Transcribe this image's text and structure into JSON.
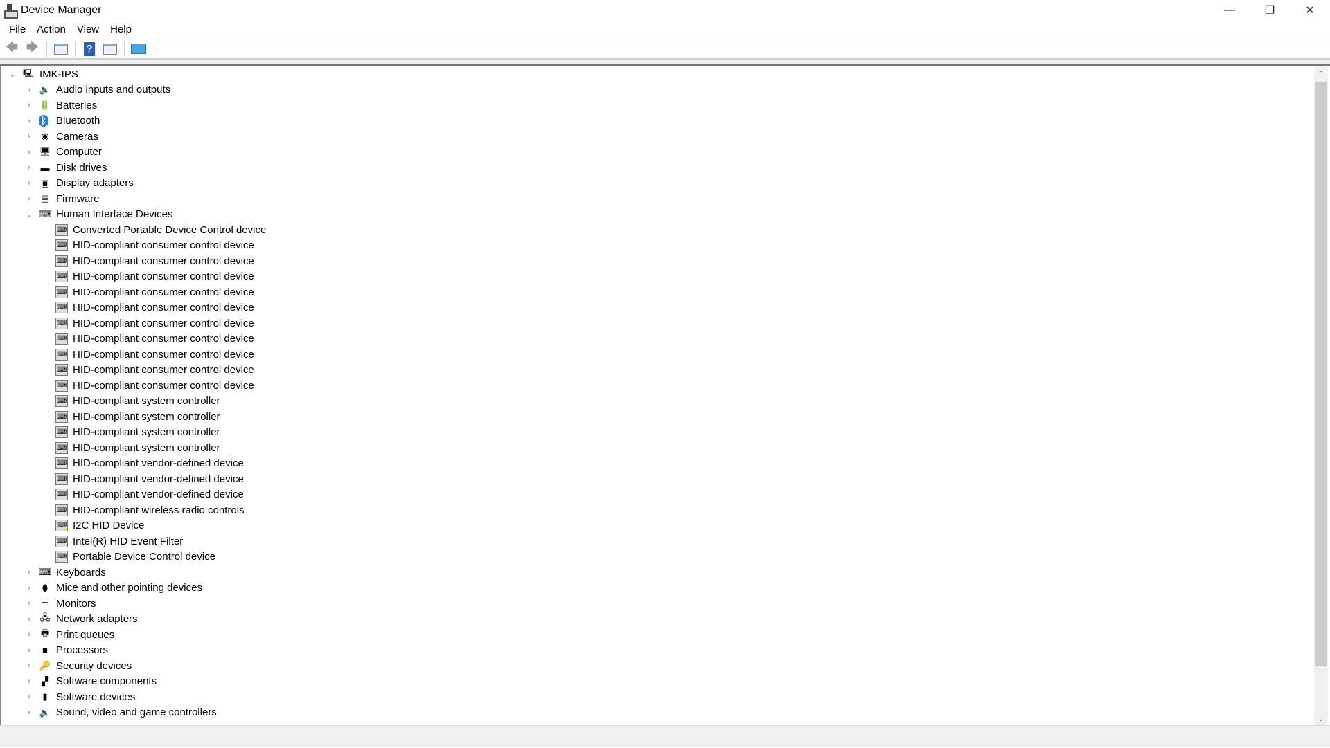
{
  "window": {
    "title": "Device Manager",
    "controls": [
      "minimize",
      "restore",
      "close"
    ]
  },
  "menu": [
    "File",
    "Action",
    "View",
    "Help"
  ],
  "toolbar": [
    "back-icon",
    "forward-icon",
    "show-hide-console-tree-icon",
    "help-icon",
    "show-action-pane-icon",
    "scan-hardware-icon"
  ],
  "tree": {
    "root": "IMK-IPS",
    "categories": [
      {
        "label": "Audio inputs and outputs",
        "icon": "speaker-icon",
        "expanded": false
      },
      {
        "label": "Batteries",
        "icon": "battery-icon",
        "expanded": false
      },
      {
        "label": "Bluetooth",
        "icon": "bluetooth-icon",
        "expanded": false
      },
      {
        "label": "Cameras",
        "icon": "camera-icon",
        "expanded": false
      },
      {
        "label": "Computer",
        "icon": "computer-icon",
        "expanded": false
      },
      {
        "label": "Disk drives",
        "icon": "disk-icon",
        "expanded": false
      },
      {
        "label": "Display adapters",
        "icon": "display-adapter-icon",
        "expanded": false
      },
      {
        "label": "Firmware",
        "icon": "firmware-icon",
        "expanded": false
      },
      {
        "label": "Human Interface Devices",
        "icon": "hid-icon",
        "expanded": true,
        "children": [
          {
            "label": "Converted Portable Device Control device"
          },
          {
            "label": "HID-compliant consumer control device"
          },
          {
            "label": "HID-compliant consumer control device"
          },
          {
            "label": "HID-compliant consumer control device"
          },
          {
            "label": "HID-compliant consumer control device"
          },
          {
            "label": "HID-compliant consumer control device"
          },
          {
            "label": "HID-compliant consumer control device"
          },
          {
            "label": "HID-compliant consumer control device"
          },
          {
            "label": "HID-compliant consumer control device"
          },
          {
            "label": "HID-compliant consumer control device"
          },
          {
            "label": "HID-compliant consumer control device"
          },
          {
            "label": "HID-compliant system controller"
          },
          {
            "label": "HID-compliant system controller"
          },
          {
            "label": "HID-compliant system controller"
          },
          {
            "label": "HID-compliant system controller"
          },
          {
            "label": "HID-compliant vendor-defined device"
          },
          {
            "label": "HID-compliant vendor-defined device"
          },
          {
            "label": "HID-compliant vendor-defined device"
          },
          {
            "label": "HID-compliant wireless radio controls"
          },
          {
            "label": "I2C HID Device",
            "warning": true
          },
          {
            "label": "Intel(R) HID Event Filter"
          },
          {
            "label": "Portable Device Control device"
          }
        ]
      },
      {
        "label": "Keyboards",
        "icon": "keyboard-icon",
        "expanded": false
      },
      {
        "label": "Mice and other pointing devices",
        "icon": "mouse-icon",
        "expanded": false
      },
      {
        "label": "Monitors",
        "icon": "monitor-icon",
        "expanded": false
      },
      {
        "label": "Network adapters",
        "icon": "network-icon",
        "expanded": false
      },
      {
        "label": "Print queues",
        "icon": "printer-icon",
        "expanded": false
      },
      {
        "label": "Processors",
        "icon": "processor-icon",
        "expanded": false
      },
      {
        "label": "Security devices",
        "icon": "security-icon",
        "expanded": false
      },
      {
        "label": "Software components",
        "icon": "software-component-icon",
        "expanded": false
      },
      {
        "label": "Software devices",
        "icon": "software-device-icon",
        "expanded": false
      },
      {
        "label": "Sound, video and game controllers",
        "icon": "speaker-icon",
        "expanded": false
      }
    ]
  },
  "colors": {
    "accent": "#2b7bd4",
    "warning": "#f2c200"
  }
}
